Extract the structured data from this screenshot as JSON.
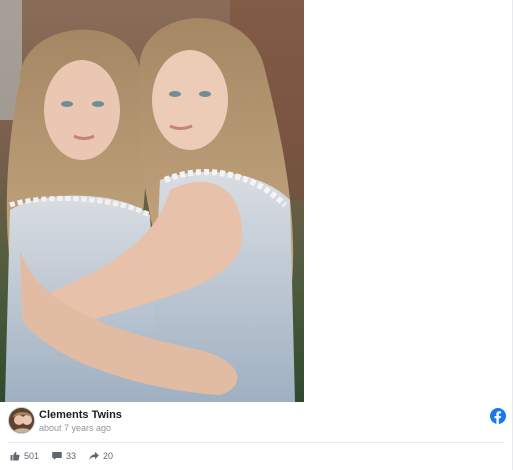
{
  "post": {
    "photo_description_icon": "photo",
    "author": {
      "name": "Clements Twins",
      "timestamp": "about 7 years ago",
      "avatar_icon": "avatar"
    },
    "source_icon": "facebook-logo-icon",
    "brand_color": "#1877f2",
    "stats": {
      "likes": "501",
      "comments": "33",
      "shares": "20"
    }
  }
}
